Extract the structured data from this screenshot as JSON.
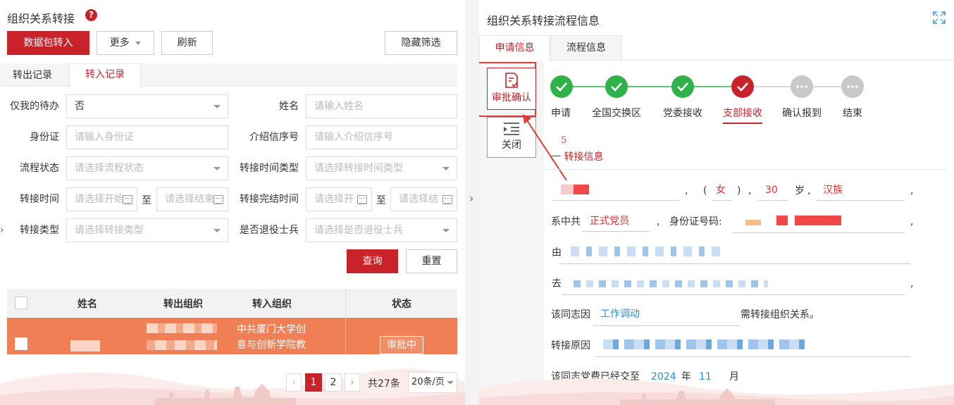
{
  "left": {
    "title": "组织关系转接",
    "toolbar": {
      "import_label": "数据包转入",
      "more_label": "更多",
      "refresh_label": "刷新",
      "hide_filter_label": "隐藏筛选"
    },
    "tabs": [
      {
        "label": "转出记录"
      },
      {
        "label": "转入记录"
      }
    ],
    "filters": {
      "my_todo": {
        "label": "仅我的待办",
        "value": "否"
      },
      "name": {
        "label": "姓名",
        "placeholder": "请输入姓名"
      },
      "id_card": {
        "label": "身份证",
        "placeholder": "请输入身份证"
      },
      "letter_no": {
        "label": "介绍信序号",
        "placeholder": "请输入介绍信序号"
      },
      "flow_status": {
        "label": "流程状态",
        "placeholder": "请选择流程状态"
      },
      "time_type": {
        "label": "转接时间类型",
        "placeholder": "请选择转接时间类型"
      },
      "transfer_time": {
        "label": "转接时间",
        "start_placeholder": "请选择开始",
        "end_placeholder": "请选择结束",
        "sep": "至"
      },
      "finish_time": {
        "label": "转接完结时间",
        "start_placeholder": "请选择开",
        "end_placeholder": "请选择结",
        "sep": "至"
      },
      "transfer_type": {
        "label": "转接类型",
        "placeholder": "请选择转接类型"
      },
      "veteran": {
        "label": "是否退役士兵",
        "placeholder": "请选择是否退役士兵"
      }
    },
    "query_label": "查询",
    "reset_label": "重置",
    "table": {
      "headers": [
        "姓名",
        "转出组织",
        "转入组织",
        "状态"
      ],
      "rows": [
        {
          "in_org_line1": "中共厦门大学创",
          "in_org_line2": "意与创新学院教",
          "status": "审批中"
        }
      ]
    },
    "pagination": {
      "pages": [
        "1",
        "2"
      ],
      "total": "共27条",
      "page_size": "20条/页"
    }
  },
  "right": {
    "title": "组织关系转接流程信息",
    "tabs": [
      {
        "label": "申请信息"
      },
      {
        "label": "流程信息"
      }
    ],
    "side_actions": {
      "approve_label": "审批确认",
      "close_label": "关闭"
    },
    "annotation": "5",
    "steps": [
      {
        "label": "申请",
        "state": "done"
      },
      {
        "label": "全国交换区",
        "state": "done"
      },
      {
        "label": "党委接收",
        "state": "done"
      },
      {
        "label": "支部接收",
        "state": "current"
      },
      {
        "label": "确认报到",
        "state": "pending"
      },
      {
        "label": "结束",
        "state": "pending"
      }
    ],
    "section_title": "一 转接信息",
    "info": {
      "sex": "女",
      "age": "30",
      "age_unit": "岁",
      "ethnicity": "汉族",
      "member_prefix": "系中共",
      "member_type": "正式党员",
      "id_label": "身份证号码:",
      "from_label": "由",
      "to_label": "去",
      "reason_prefix": "该同志因",
      "reason": "工作调动",
      "reason_suffix": "需转接组织关系。",
      "transfer_reason_label": "转接原因",
      "dues_prefix": "该同志党费已经交至",
      "dues_year": "2024",
      "year_label": "年",
      "dues_month": "11",
      "month_label": "月"
    }
  },
  "colors": {
    "primary": "#c8222a",
    "done": "#2fb24a",
    "pending": "#c8c8c8",
    "row_highlight": "#f07f56"
  }
}
